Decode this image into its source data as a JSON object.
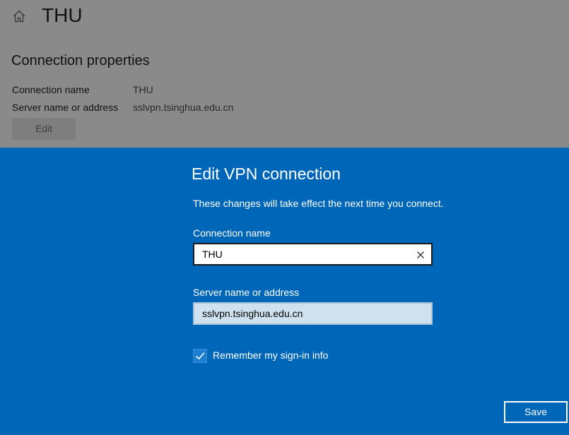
{
  "background_page": {
    "home_icon": "home-icon",
    "title": "THU",
    "section_title": "Connection properties",
    "properties": [
      {
        "label": "Connection name",
        "value": "THU"
      },
      {
        "label": "Server name or address",
        "value": "sslvpn.tsinghua.edu.cn"
      }
    ],
    "edit_label": "Edit"
  },
  "dialog": {
    "title": "Edit VPN connection",
    "description": "These changes will take effect the next time you connect.",
    "connection_name": {
      "label": "Connection name",
      "value": "THU",
      "clear_icon": "close-icon"
    },
    "server": {
      "label": "Server name or address",
      "value": "sslvpn.tsinghua.edu.cn"
    },
    "remember": {
      "label": "Remember my sign-in info",
      "checked": true,
      "icon": "check-icon"
    },
    "save_label": "Save"
  },
  "colors": {
    "dialog_background": "#0067b8",
    "dimmed_background": "#8a8a8a"
  }
}
